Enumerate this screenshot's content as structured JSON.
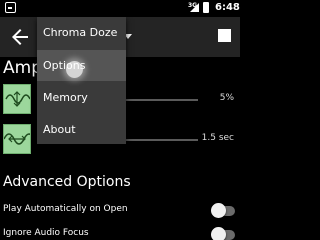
{
  "status_bar": {
    "network": "3G",
    "time": "6:48"
  },
  "app_bar": {
    "title": "Chroma Doze"
  },
  "amplitude": {
    "title": "Amplitude",
    "rows": [
      {
        "value": "5%"
      },
      {
        "value": "1.5 sec"
      }
    ]
  },
  "advanced": {
    "title": "Advanced Options",
    "settings": [
      {
        "label": "Play Automatically on Open",
        "enabled": false
      },
      {
        "label": "Ignore Audio Focus",
        "enabled": false
      }
    ]
  },
  "menu": {
    "items": [
      {
        "label": "Chroma Doze"
      },
      {
        "label": "Options"
      },
      {
        "label": "Memory"
      },
      {
        "label": "About"
      }
    ]
  },
  "colors": {
    "app_bar": "#242424",
    "menu_bg": "#3a3a3a",
    "row_icon": "#9cd79c"
  }
}
